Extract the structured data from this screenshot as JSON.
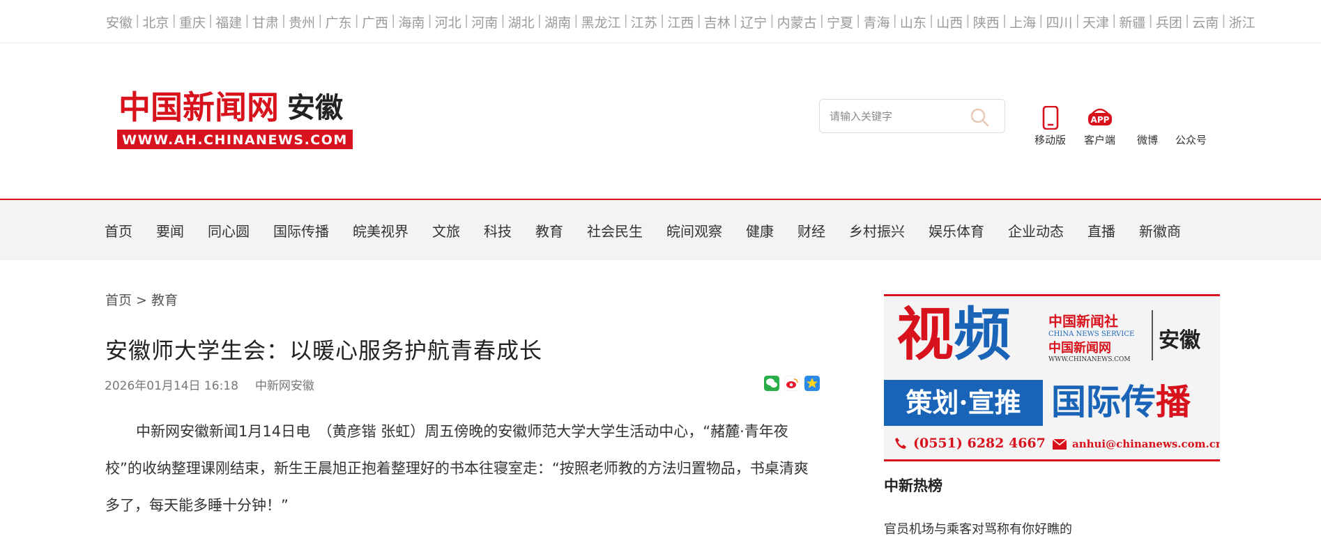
{
  "regions": [
    "安徽",
    "北京",
    "重庆",
    "福建",
    "甘肃",
    "贵州",
    "广东",
    "广西",
    "海南",
    "河北",
    "河南",
    "湖北",
    "湖南",
    "黑龙江",
    "江苏",
    "江西",
    "吉林",
    "辽宁",
    "内蒙古",
    "宁夏",
    "青海",
    "山东",
    "山西",
    "陕西",
    "上海",
    "四川",
    "天津",
    "新疆",
    "兵团",
    "云南",
    "浙江"
  ],
  "header": {
    "logo_text": "中国新闻网",
    "logo_region": "安徽",
    "logo_url_text": "WWW.AH.CHINANEWS.COM",
    "search_placeholder": "请输入关键字",
    "links": [
      {
        "label": "移动版",
        "icon": "mobile-icon"
      },
      {
        "label": "客户端",
        "icon": "app-icon",
        "badge": "APP"
      },
      {
        "label": "微博",
        "icon": "weibo-icon"
      },
      {
        "label": "公众号",
        "icon": "wechat-icon"
      }
    ]
  },
  "nav": [
    "首页",
    "要闻",
    "同心圆",
    "国际传播",
    "皖美视界",
    "文旅",
    "科技",
    "教育",
    "社会民生",
    "皖间观察",
    "健康",
    "财经",
    "乡村振兴",
    "娱乐体育",
    "企业动态",
    "直播",
    "新徽商"
  ],
  "breadcrumb": {
    "home": "首页",
    "sep": ">",
    "current": "教育"
  },
  "article": {
    "title": "安徽师大学生会：以暖心服务护航青春成长",
    "date": "2026年01月14日 16:18",
    "source": "中新网安徽",
    "body": "中新网安徽新闻1月14日电　（黄彦锴 张虹）周五傍晚的安徽师范大学大学生活动中心，“赭麓·青年夜校”的收纳整理课刚结束，新生王晨旭正抱着整理好的书本往寝室走：“按照老师教的方法归置物品，书桌清爽多了，每天能多睡十分钟！”"
  },
  "promo": {
    "big_a": "视",
    "big_b": "频",
    "org_cn": "中国新闻社",
    "org_en": "CHINA NEWS SERVICE",
    "org_site": "中国新闻网",
    "org_url": "WWW.CHINANEWS.COM",
    "region": "安徽",
    "banner": "策划·宣推",
    "intl_a": "国际传",
    "intl_b": "播",
    "phone": "(0551) 6282 4667",
    "email": "anhui@chinanews.com.cn"
  },
  "sidebar": {
    "hot_title": "中新热榜",
    "hot_items": [
      "官员机场与乘客对骂称有你好瞧的"
    ]
  },
  "colors": {
    "brand_red": "#d8121d",
    "brand_blue": "#1a64b8",
    "nav_bg": "#f3f3f3"
  }
}
